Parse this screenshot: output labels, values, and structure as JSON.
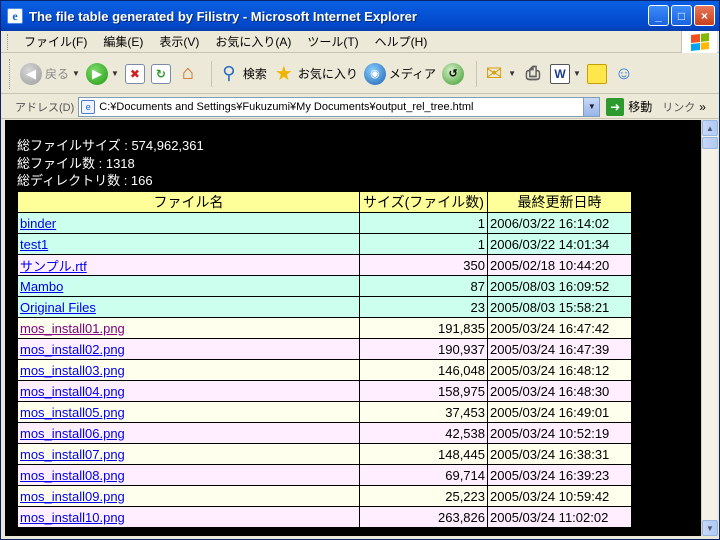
{
  "window": {
    "title": "The file table generated by Filistry - Microsoft Internet Explorer",
    "minimize": "_",
    "maximize": "□",
    "close": "×"
  },
  "menu": {
    "items": [
      "ファイル(F)",
      "編集(E)",
      "表示(V)",
      "お気に入り(A)",
      "ツール(T)",
      "ヘルプ(H)"
    ]
  },
  "toolbar": {
    "back": "戻る",
    "search": "検索",
    "favorites": "お気に入り",
    "media": "メディア"
  },
  "address": {
    "label": "アドレス(D)",
    "url": "C:¥Documents and Settings¥Fukuzumi¥My Documents¥output_rel_tree.html",
    "go": "移動",
    "links": "リンク"
  },
  "summary": {
    "total_size": "総ファイルサイズ : 574,962,361",
    "total_files": "総ファイル数 : 1318",
    "total_dirs": "総ディレクトリ数 : 166"
  },
  "table": {
    "headers": [
      "ファイル名",
      "サイズ(ファイル数)",
      "最終更新日時"
    ],
    "rows": [
      {
        "name": "binder",
        "size": "1",
        "date": "2006/03/22 16:14:02",
        "kind": "dir",
        "level": 0
      },
      {
        "name": "test1",
        "size": "1",
        "date": "2006/03/22 14:01:34",
        "kind": "dir",
        "level": 1
      },
      {
        "name": "サンプル.rtf",
        "size": "350",
        "date": "2005/02/18 10:44:20",
        "kind": "file1",
        "level": 2
      },
      {
        "name": "Mambo",
        "size": "87",
        "date": "2005/08/03 16:09:52",
        "kind": "dir",
        "level": 0
      },
      {
        "name": "Original Files",
        "size": "23",
        "date": "2005/08/03 15:58:21",
        "kind": "dir",
        "level": 1
      },
      {
        "name": "mos_install01.png",
        "size": "191,835",
        "date": "2005/03/24 16:47:42",
        "kind": "file2",
        "level": 2,
        "visited": true
      },
      {
        "name": "mos_install02.png",
        "size": "190,937",
        "date": "2005/03/24 16:47:39",
        "kind": "file1",
        "level": 2
      },
      {
        "name": "mos_install03.png",
        "size": "146,048",
        "date": "2005/03/24 16:48:12",
        "kind": "file2",
        "level": 2
      },
      {
        "name": "mos_install04.png",
        "size": "158,975",
        "date": "2005/03/24 16:48:30",
        "kind": "file1",
        "level": 2
      },
      {
        "name": "mos_install05.png",
        "size": "37,453",
        "date": "2005/03/24 16:49:01",
        "kind": "file2",
        "level": 2
      },
      {
        "name": "mos_install06.png",
        "size": "42,538",
        "date": "2005/03/24 10:52:19",
        "kind": "file1",
        "level": 2
      },
      {
        "name": "mos_install07.png",
        "size": "148,445",
        "date": "2005/03/24 16:38:31",
        "kind": "file2",
        "level": 2
      },
      {
        "name": "mos_install08.png",
        "size": "69,714",
        "date": "2005/03/24 16:39:23",
        "kind": "file1",
        "level": 2
      },
      {
        "name": "mos_install09.png",
        "size": "25,223",
        "date": "2005/03/24 10:59:42",
        "kind": "file2",
        "level": 2
      },
      {
        "name": "mos_install10.png",
        "size": "263,826",
        "date": "2005/03/24 11:02:02",
        "kind": "file1",
        "level": 2
      }
    ]
  }
}
